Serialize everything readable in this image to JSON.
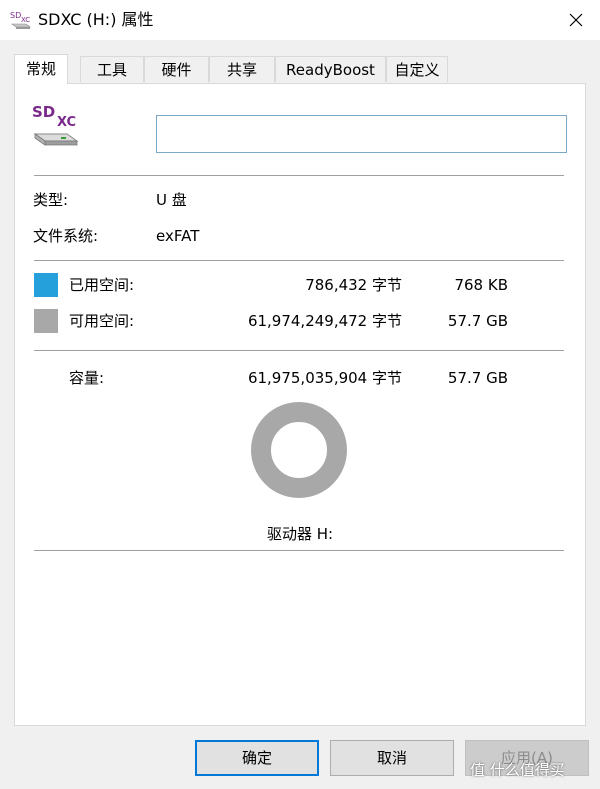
{
  "window": {
    "title": "SDXC (H:) 属性",
    "title_icon": "sd-card-icon",
    "close_icon": "close-icon"
  },
  "tabs": [
    {
      "label": "常规",
      "active": true
    },
    {
      "label": "工具",
      "active": false
    },
    {
      "label": "硬件",
      "active": false
    },
    {
      "label": "共享",
      "active": false
    },
    {
      "label": "ReadyBoost",
      "active": false
    },
    {
      "label": "自定义",
      "active": false
    }
  ],
  "general": {
    "drive_icon": "sdxc-drive-icon",
    "drive_icon_text": "SDXC",
    "name_field": {
      "value": "",
      "placeholder": ""
    },
    "type_label": "类型:",
    "type_value": "U 盘",
    "fs_label": "文件系统:",
    "fs_value": "exFAT",
    "used": {
      "label": "已用空间:",
      "bytes": "786,432 字节",
      "size": "768 KB",
      "color": "#26a0da",
      "fraction": 1.27e-05
    },
    "free": {
      "label": "可用空间:",
      "bytes": "61,974,249,472 字节",
      "size": "57.7 GB",
      "color": "#a8a8a8"
    },
    "capacity": {
      "label": "容量:",
      "bytes": "61,975,035,904 字节",
      "size": "57.7 GB"
    },
    "drive_label": "驱动器 H:"
  },
  "buttons": {
    "ok": "确定",
    "cancel": "取消",
    "apply": "应用(A)"
  },
  "watermark": {
    "text": "值 什么值得买"
  }
}
